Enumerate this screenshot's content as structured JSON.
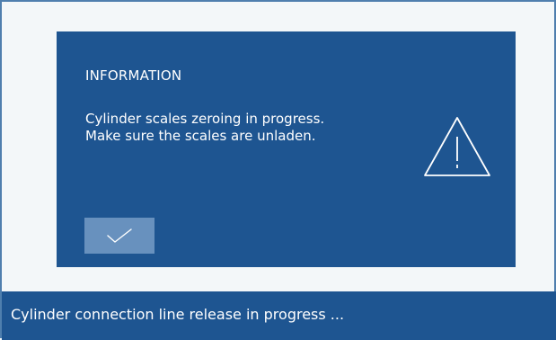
{
  "dialog": {
    "title": "INFORMATION",
    "message_lines": [
      "Cylinder scales zeroing in progress.",
      "Make sure the scales are unladen."
    ],
    "icon": "warning-icon",
    "confirm_icon": "checkmark-icon"
  },
  "status_bar": {
    "text": "Cylinder connection line release in progress ..."
  },
  "colors": {
    "dialog_background": "#1e5591",
    "button_background": "#6891be",
    "page_background": "#f3f7f9"
  }
}
